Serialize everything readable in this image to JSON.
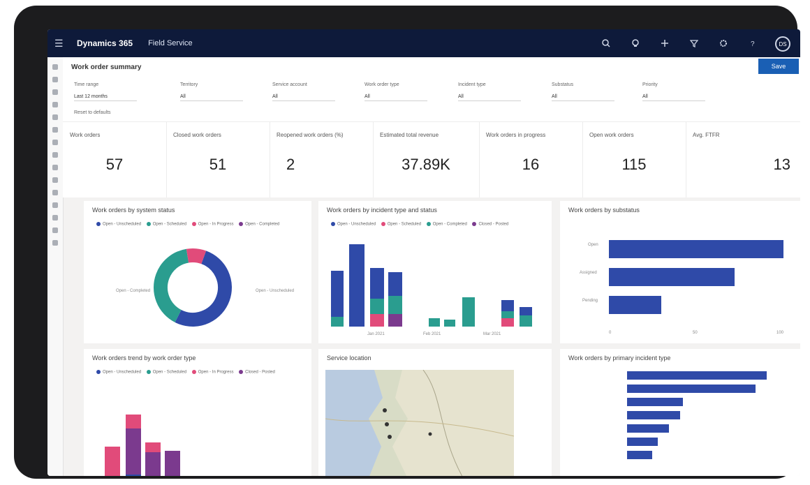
{
  "topbar": {
    "brand": "Dynamics 365",
    "app": "Field Service"
  },
  "header": {
    "title": "Work order summary",
    "save": "Save"
  },
  "filters": [
    {
      "label": "Time range",
      "value": "Last 12 months"
    },
    {
      "label": "Territory",
      "value": "All"
    },
    {
      "label": "Service account",
      "value": "All"
    },
    {
      "label": "Work order type",
      "value": "All"
    },
    {
      "label": "Incident type",
      "value": "All"
    },
    {
      "label": "Substatus",
      "value": "All"
    },
    {
      "label": "Priority",
      "value": "All"
    }
  ],
  "filter_link": "Reset to defaults",
  "kpis": [
    {
      "label": "Work orders",
      "value": "57"
    },
    {
      "label": "Closed work orders",
      "value": "51"
    },
    {
      "label": "Reopened work orders (%)",
      "value": "2"
    },
    {
      "label": "Estimated total revenue",
      "value": "37.89K"
    },
    {
      "label": "Work orders in progress",
      "value": "16"
    },
    {
      "label": "Open work orders",
      "value": "115"
    },
    {
      "label": "Avg. FTFR",
      "value": "13"
    }
  ],
  "cards": {
    "donut": {
      "title": "Work orders by system status",
      "legend": [
        "Open - Unscheduled",
        "Open - Scheduled",
        "Open - In Progress",
        "Open - Completed"
      ],
      "colors": [
        "#2f4aa8",
        "#2a9d8f",
        "#e14b7a",
        "#7b3a8e"
      ],
      "values": [
        52,
        40,
        8
      ],
      "label_left": "Open - Completed",
      "label_right": "Open - Unscheduled"
    },
    "stacked": {
      "title": "Work orders by incident type and status",
      "legend": [
        "Open - Unscheduled",
        "Open - Scheduled",
        "Open - Completed",
        "Closed - Posted"
      ],
      "x_ticks": [
        "Jan 2021",
        "Feb 2021",
        "Mar 2021"
      ]
    },
    "hbar": {
      "title": "Work orders by substatus",
      "categories": [
        "Open",
        "Assigned",
        "Pending"
      ],
      "values": [
        100,
        72,
        30
      ],
      "x_ticks": [
        "0",
        "50",
        "100"
      ]
    },
    "stacked2": {
      "title": "Work orders trend by work order type",
      "legend": [
        "Open - Unscheduled",
        "Open - Scheduled",
        "Open - In Progress",
        "Closed - Posted"
      ]
    },
    "map": {
      "title": "Service location"
    },
    "hbar2": {
      "title": "Work orders by primary incident type",
      "values": [
        100,
        92,
        40,
        38,
        30,
        22,
        18
      ]
    }
  },
  "colors": {
    "navy": "#2f4aa8",
    "teal": "#2a9d8f",
    "pink": "#e14b7a",
    "purple": "#7b3a8e",
    "topbar": "#0e1a3a",
    "accent": "#1a5fb4"
  }
}
